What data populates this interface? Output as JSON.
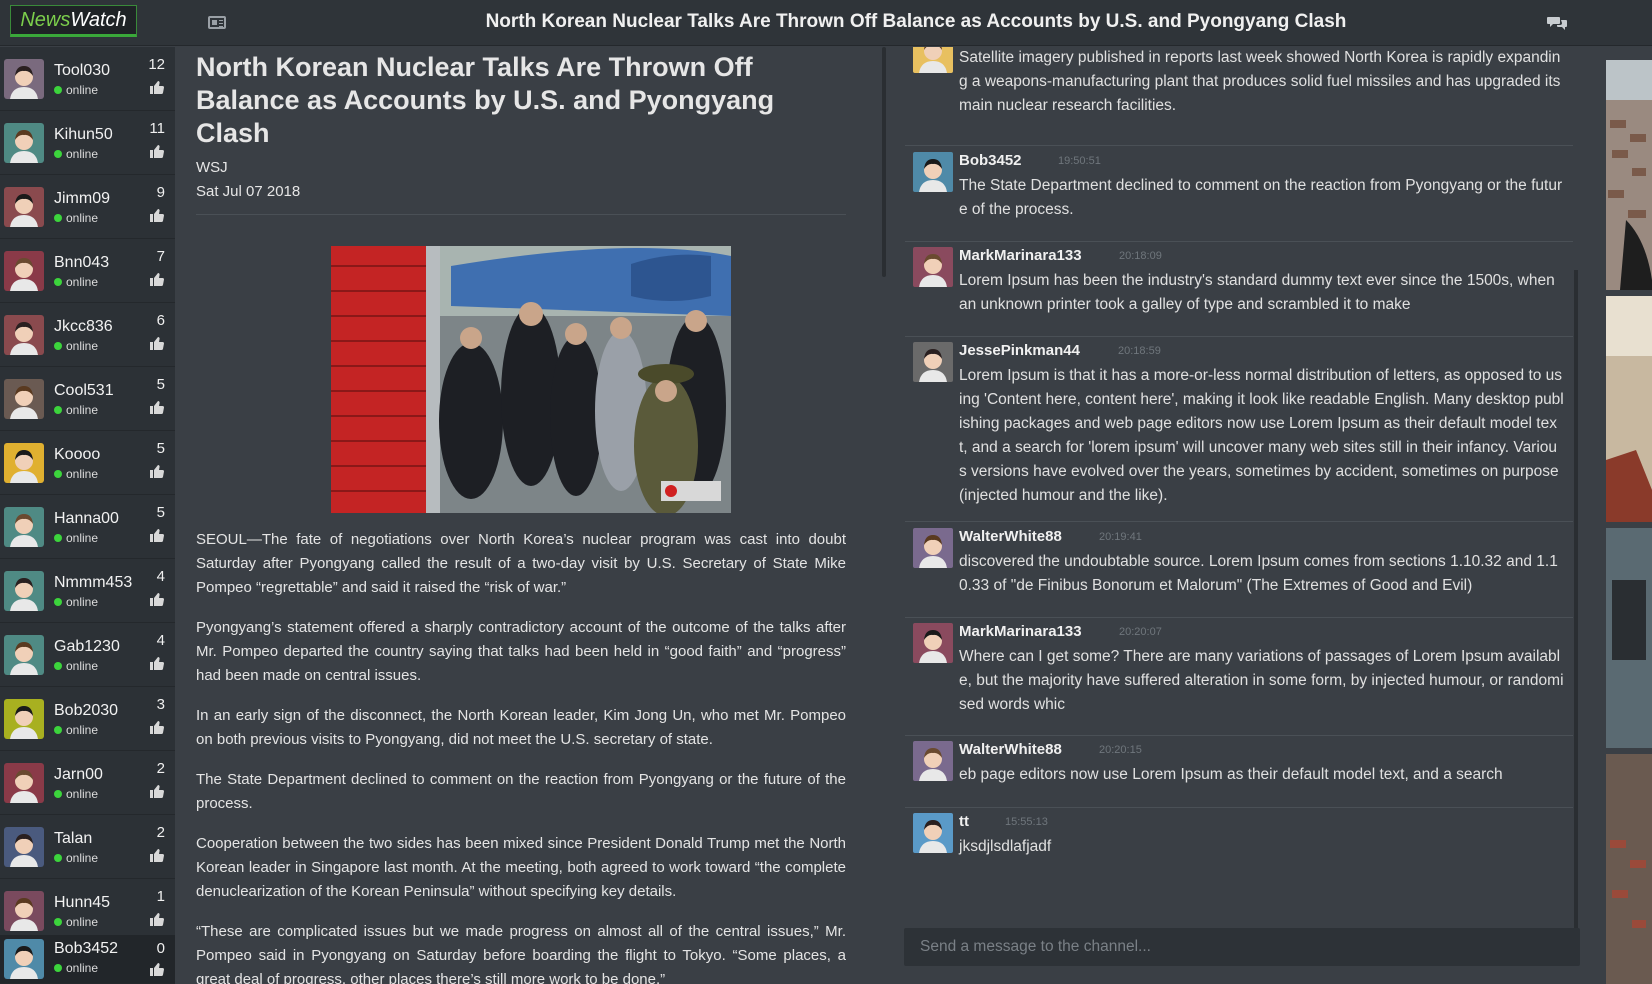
{
  "app": {
    "logo_first": "News",
    "logo_second": "Watch"
  },
  "header": {
    "title": "North Korean Nuclear Talks Are Thrown Off Balance as Accounts by U.S. and Pyongyang Clash"
  },
  "sidebar": {
    "users": [
      {
        "name": "Tool030",
        "status": "online",
        "count": "12",
        "avatar_color": "#7a6a7e"
      },
      {
        "name": "Kihun50",
        "status": "online",
        "count": "11",
        "avatar_color": "#4f8a84"
      },
      {
        "name": "Jimm09",
        "status": "online",
        "count": "9",
        "avatar_color": "#8a4a4e"
      },
      {
        "name": "Bnn043",
        "status": "online",
        "count": "7",
        "avatar_color": "#8a3a48"
      },
      {
        "name": "Jkcc836",
        "status": "online",
        "count": "6",
        "avatar_color": "#8a4a4e"
      },
      {
        "name": "Cool531",
        "status": "online",
        "count": "5",
        "avatar_color": "#6a5a52"
      },
      {
        "name": "Koooo",
        "status": "online",
        "count": "5",
        "avatar_color": "#e0b030"
      },
      {
        "name": "Hanna00",
        "status": "online",
        "count": "5",
        "avatar_color": "#4f8a84"
      },
      {
        "name": "Nmmm453",
        "status": "online",
        "count": "4",
        "avatar_color": "#4f8a84"
      },
      {
        "name": "Gab1230",
        "status": "online",
        "count": "4",
        "avatar_color": "#4f8a84"
      },
      {
        "name": "Bob2030",
        "status": "online",
        "count": "3",
        "avatar_color": "#a8b020"
      },
      {
        "name": "Jarn00",
        "status": "online",
        "count": "2",
        "avatar_color": "#8a3a48"
      },
      {
        "name": "Talan",
        "status": "online",
        "count": "2",
        "avatar_color": "#4a5a7e"
      },
      {
        "name": "Hunn45",
        "status": "online",
        "count": "1",
        "avatar_color": "#7a4a5e"
      },
      {
        "name": "Bob3452",
        "status": "online",
        "count": "0",
        "avatar_color": "#4f8aa8"
      }
    ]
  },
  "article": {
    "title": "North Korean Nuclear Talks Are Thrown Off Balance as Accounts by U.S. and Pyongyang Clash",
    "source": "WSJ",
    "date": "Sat Jul 07 2018",
    "paragraphs": [
      "SEOUL—The fate of negotiations over North Korea’s nuclear program was cast into doubt Saturday after Pyongyang called the result of a two-day visit by U.S. Secretary of State Mike Pompeo “regrettable” and said it raised the “risk of war.”",
      "Pyongyang’s statement offered a sharply contradictory account of the outcome of the talks after Mr. Pompeo departed the country saying that talks had been held in “good faith” and “progress” had been made on central issues.",
      "In an early sign of the disconnect, the North Korean leader, Kim Jong Un, who met Mr. Pompeo on both previous visits to Pyongyang, did not meet the U.S. secretary of state.",
      "The State Department declined to comment on the reaction from Pyongyang or the future of the process.",
      "Cooperation between the two sides has been mixed since President Donald Trump met the North Korean leader in Singapore last month. At the meeting, both agreed to work toward “the complete denuclearization of the Korean Peninsula” without specifying key details.",
      "“These are complicated issues but we made progress on almost all of the central issues,” Mr. Pompeo said in Pyongyang on Saturday before boarding the flight to Tokyo. “Some places, a great deal of progress, other places there’s still more work to be done.”"
    ]
  },
  "chat": {
    "messages": [
      {
        "user": "",
        "time": "",
        "text": "Satellite imagery published in reports last week showed North Korea is rapidly expanding a weapons-manufacturing plant that produces solid fuel missiles and has upgraded its main nuclear research facilities.",
        "avatar_color": "#e8c060"
      },
      {
        "user": "Bob3452",
        "time": "19:50:51",
        "text": "The State Department declined to comment on the reaction from Pyongyang or the future of the process.",
        "avatar_color": "#4f8aa8"
      },
      {
        "user": "MarkMarinara133",
        "time": "20:18:09",
        "text": "Lorem Ipsum has been the industry's standard dummy text ever since the 1500s, when an unknown printer took a galley of type and scrambled it to make",
        "avatar_color": "#8a4a5e"
      },
      {
        "user": "JessePinkman44",
        "time": "20:18:59",
        "text": "Lorem Ipsum is that it has a more-or-less normal distribution of letters, as opposed to using 'Content here, content here', making it look like readable English. Many desktop publishing packages and web page editors now use Lorem Ipsum as their default model text, and a search for 'lorem ipsum' will uncover many web sites still in their infancy. Various versions have evolved over the years, sometimes by accident, sometimes on purpose (injected humour and the like).",
        "avatar_color": "#6a6a6a"
      },
      {
        "user": "WalterWhite88",
        "time": "20:19:41",
        "text": "discovered the undoubtable source. Lorem Ipsum comes from sections 1.10.32 and 1.10.33 of \"de Finibus Bonorum et Malorum\" (The Extremes of Good and Evil)",
        "avatar_color": "#7a6a8e"
      },
      {
        "user": "MarkMarinara133",
        "time": "20:20:07",
        "text": "Where can I get some? There are many variations of passages of Lorem Ipsum available, but the majority have suffered alteration in some form, by injected humour, or randomised words whic",
        "avatar_color": "#8a4a5e"
      },
      {
        "user": "WalterWhite88",
        "time": "20:20:15",
        "text": "eb page editors now use Lorem Ipsum as their default model text, and a search",
        "avatar_color": "#7a6a8e"
      },
      {
        "user": "tt",
        "time": "15:55:13",
        "text": "jksdjlsdlafjadf",
        "avatar_color": "#5a9ac8"
      }
    ],
    "input_placeholder": "Send a message to the channel..."
  },
  "icons": {
    "news": "newspaper-icon",
    "chat": "chat-bubbles-icon",
    "like": "thumbs-up-icon"
  }
}
